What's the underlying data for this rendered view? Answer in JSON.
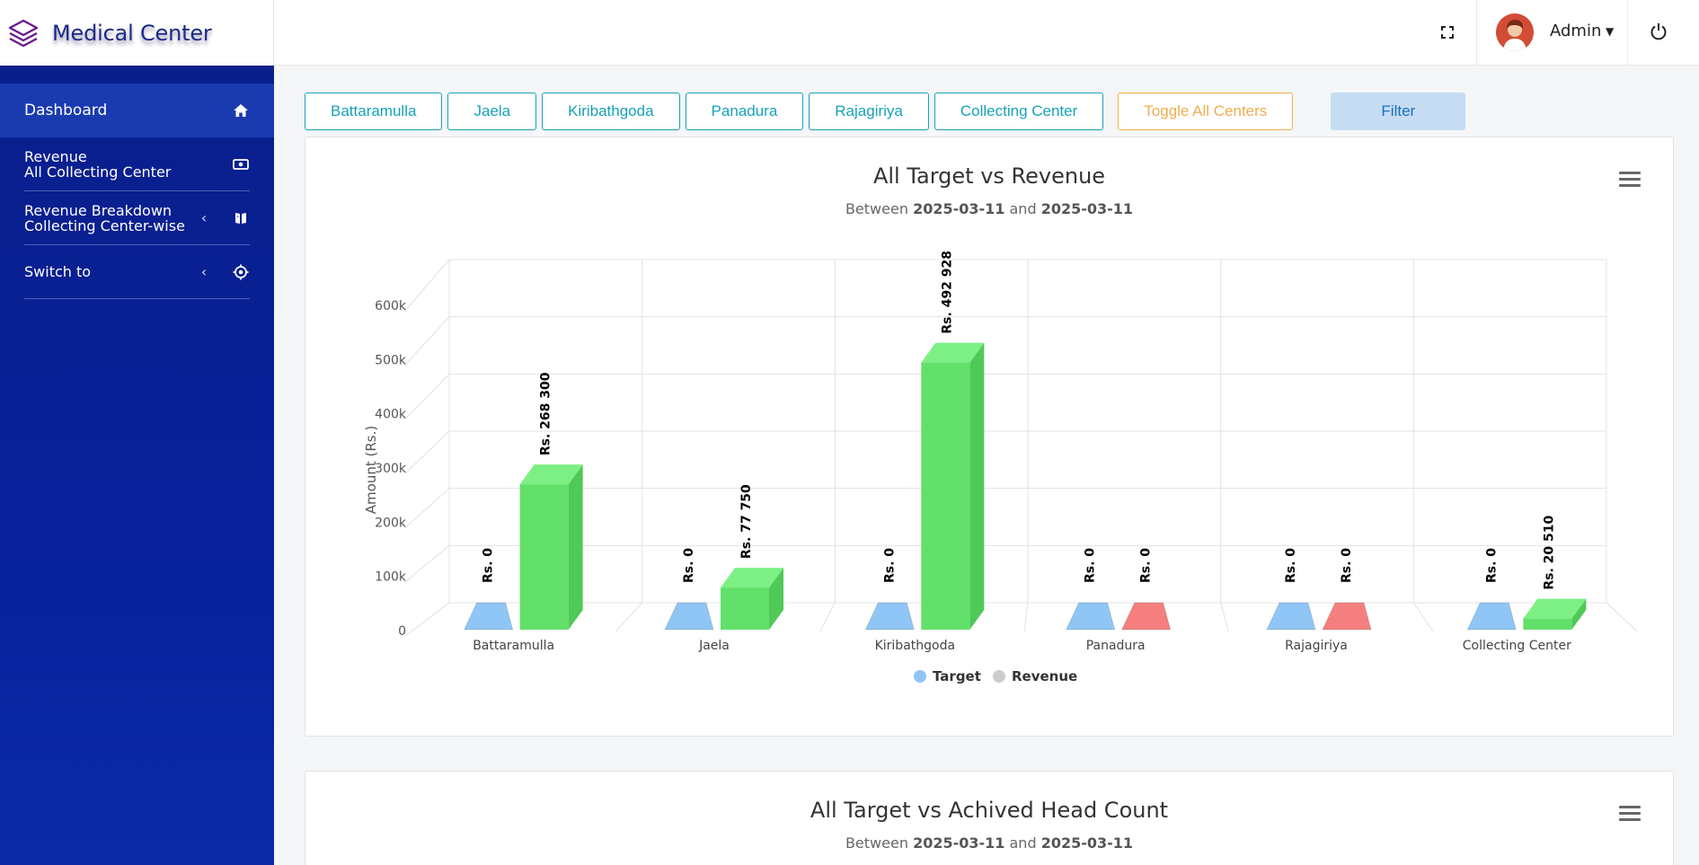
{
  "brand": {
    "name": "Medical Center",
    "logo_icon": "layers-icon"
  },
  "sidebar": {
    "items": [
      {
        "label": "Dashboard",
        "icon": "home-icon",
        "active": true
      },
      {
        "label_line1": "Revenue",
        "label_line2": "All Collecting Center",
        "icon": "money-icon"
      },
      {
        "label_line1": "Revenue Breakdown",
        "label_line2": "Collecting Center-wise",
        "icon": "book-icon",
        "chevron": true
      },
      {
        "label": "Switch to",
        "icon": "crosshair-icon",
        "chevron": true
      }
    ]
  },
  "header": {
    "user_name": "Admin"
  },
  "filters": {
    "centers": [
      "Battaramulla",
      "Jaela",
      "Kiribathgoda",
      "Panadura",
      "Rajagiriya",
      "Collecting Center"
    ],
    "toggle_label": "Toggle All Centers",
    "filter_label": "Filter"
  },
  "colors": {
    "target": "#90c6f5",
    "revenue": "#62e06a",
    "zero_revenue": "#f57f7f",
    "legend_revenue": "#cccccc",
    "accent": "#17a2b8",
    "warning": "#f0ad4e"
  },
  "chart_data": [
    {
      "type": "bar",
      "title": "All Target vs Revenue",
      "subtitle_prefix": "Between",
      "date_from": "2025-03-11",
      "subtitle_mid": "and",
      "date_to": "2025-03-11",
      "ylabel": "Amount (Rs.)",
      "xlabel": "",
      "ylim": [
        0,
        600000
      ],
      "yticks": [
        0,
        100000,
        200000,
        300000,
        400000,
        500000,
        600000
      ],
      "ytick_labels": [
        "0",
        "100k",
        "200k",
        "300k",
        "400k",
        "500k",
        "600k"
      ],
      "categories": [
        "Battaramulla",
        "Jaela",
        "Kiribathgoda",
        "Panadura",
        "Rajagiriya",
        "Collecting Center"
      ],
      "series": [
        {
          "name": "Target",
          "values": [
            0,
            0,
            0,
            0,
            0,
            0
          ],
          "labels": [
            "Rs. 0",
            "Rs. 0",
            "Rs. 0",
            "Rs. 0",
            "Rs. 0",
            "Rs. 0"
          ]
        },
        {
          "name": "Revenue",
          "values": [
            268300,
            77750,
            492928,
            0,
            0,
            20510
          ],
          "labels": [
            "Rs. 268 300",
            "Rs. 77 750",
            "Rs. 492 928",
            "Rs. 0",
            "Rs. 0",
            "Rs. 20 510"
          ]
        }
      ],
      "legend": "bottom-center",
      "grid": true
    },
    {
      "type": "bar",
      "title": "All Target vs Achived Head Count",
      "subtitle_prefix": "Between",
      "date_from": "2025-03-11",
      "subtitle_mid": "and",
      "date_to": "2025-03-11"
    }
  ]
}
